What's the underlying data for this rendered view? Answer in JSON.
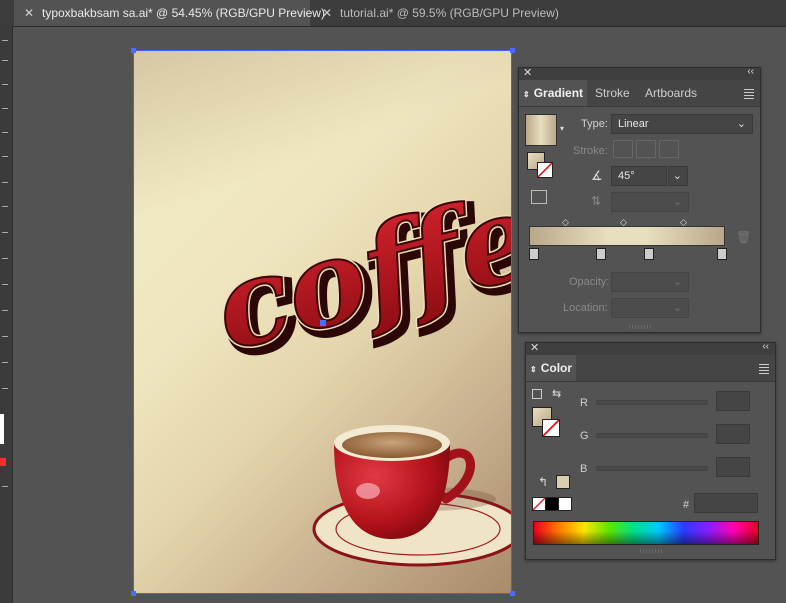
{
  "tabs": [
    {
      "label": "typoxbakbsam sa.ai* @ 54.45% (RGB/GPU Preview)",
      "active": true
    },
    {
      "label": "tutorial.ai* @ 59.5% (RGB/GPU Preview)",
      "active": false
    }
  ],
  "artwork": {
    "headline": "coffee"
  },
  "gradient_panel": {
    "tabs": [
      "Gradient",
      "Stroke",
      "Artboards"
    ],
    "type_label": "Type:",
    "type_value": "Linear",
    "stroke_label": "Stroke:",
    "angle_value": "45°",
    "opacity_label": "Opacity:",
    "location_label": "Location:",
    "gradient_colors": [
      "#b9a78a",
      "#e8dfbe"
    ]
  },
  "color_panel": {
    "title": "Color",
    "channels": [
      "R",
      "G",
      "B"
    ],
    "hex_label": "#"
  },
  "colors": {
    "accent": "#4a5cff",
    "cup_red": "#b3121b"
  }
}
